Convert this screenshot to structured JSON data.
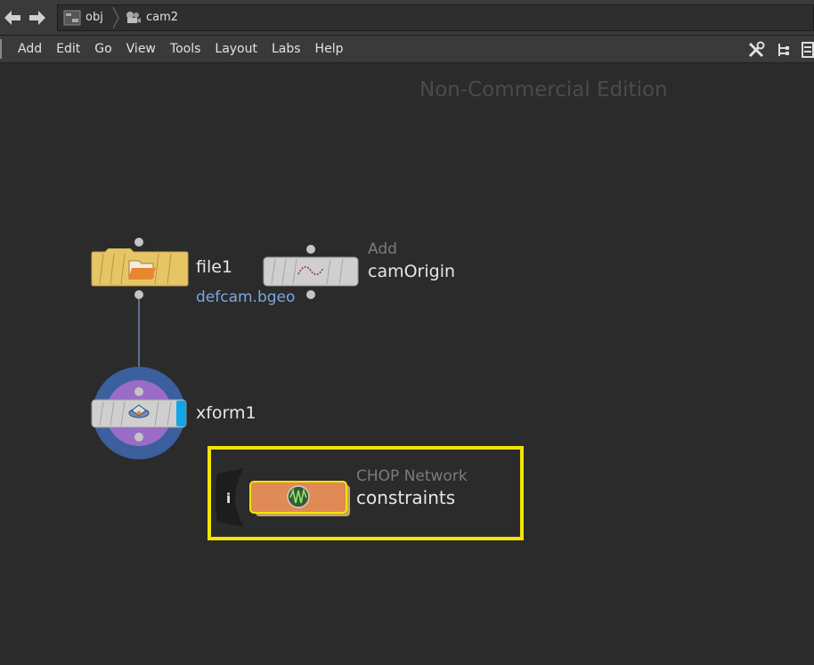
{
  "pathbar": {
    "back_icon": "arrow-left-icon",
    "forward_icon": "arrow-right-icon",
    "crumbs": [
      {
        "label": "obj",
        "icon": "obj-network-icon"
      },
      {
        "label": "cam2",
        "icon": "camera-icon"
      }
    ]
  },
  "menubar": {
    "items": [
      "Add",
      "Edit",
      "Go",
      "View",
      "Tools",
      "Layout",
      "Labs",
      "Help"
    ],
    "right_icons": [
      "tools-icon",
      "tree-view-icon",
      "list-view-icon"
    ]
  },
  "canvas": {
    "watermark": "Non-Commercial Edition",
    "nodes": {
      "file1": {
        "name": "file1",
        "subtitle": "defcam.bgeo",
        "color": "#e8c86a"
      },
      "camOrigin": {
        "name": "camOrigin",
        "type": "Add",
        "color": "#cfcfcf"
      },
      "xform1": {
        "name": "xform1",
        "color": "#cfcfcf",
        "ring_outer": "#3c5f9e",
        "ring_inner": "#9b6bc8",
        "flag": "#12a5e8"
      },
      "constraints": {
        "name": "constraints",
        "type": "CHOP Network",
        "color": "#e08a55",
        "info": "i"
      }
    },
    "selection_color": "#f2e400"
  }
}
